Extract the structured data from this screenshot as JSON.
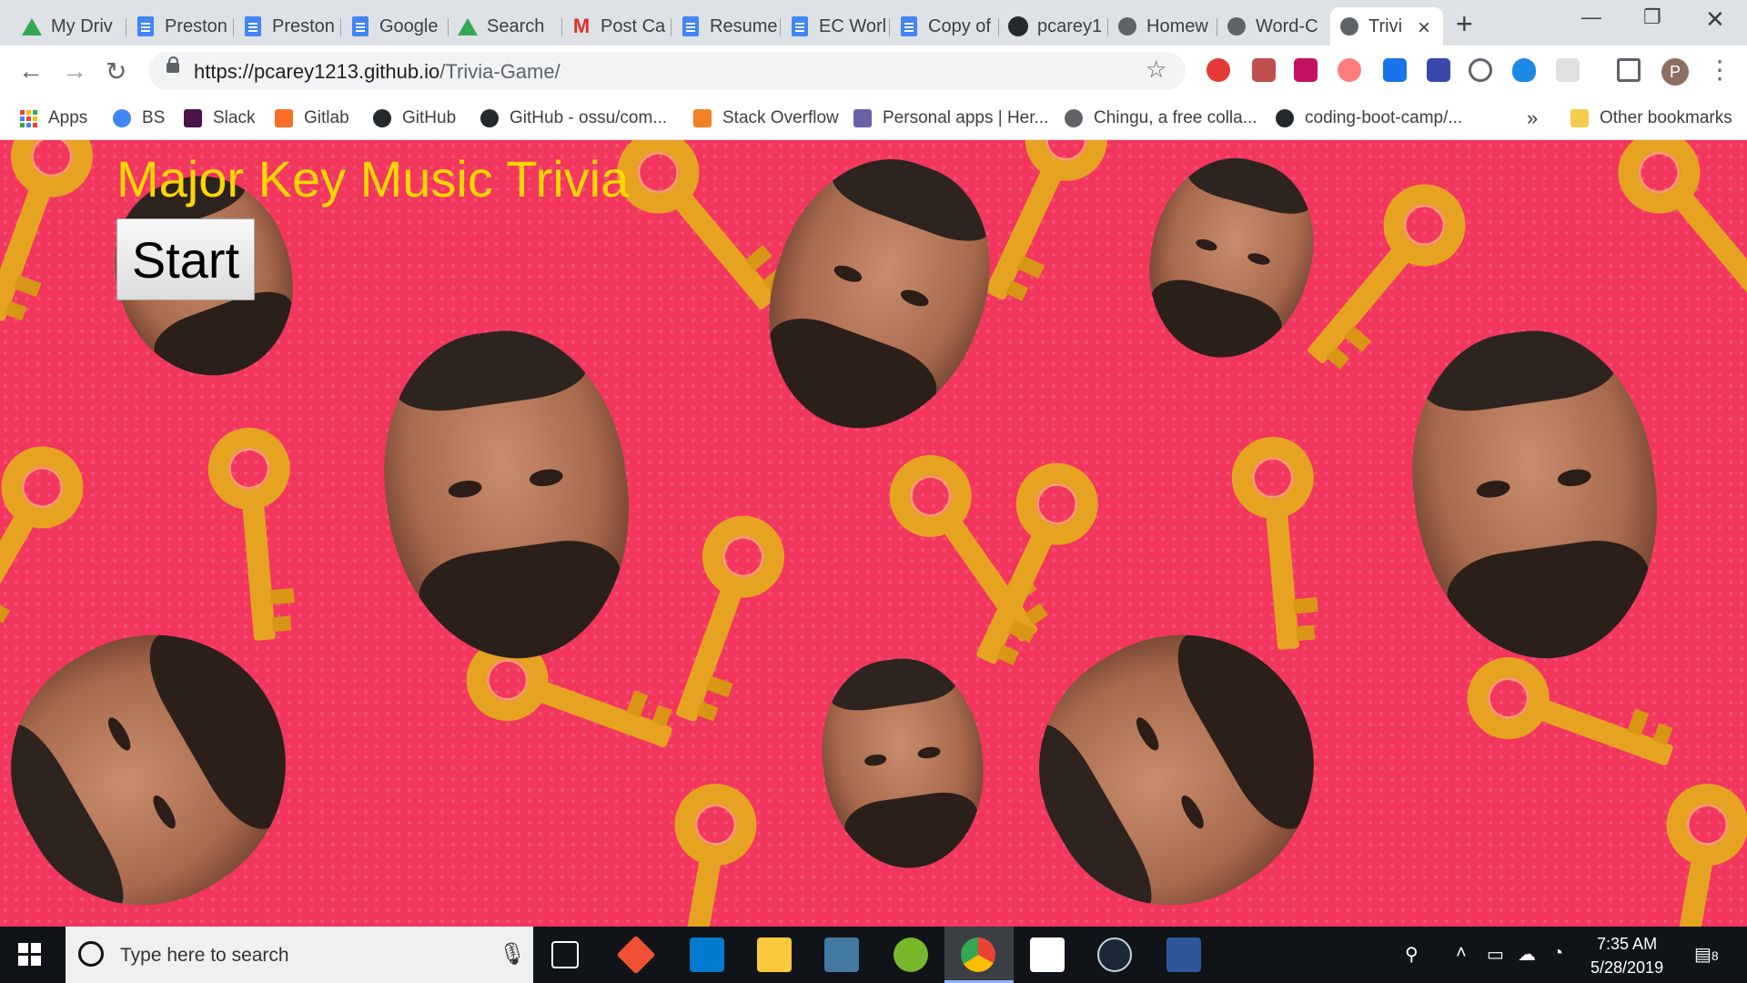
{
  "browser": {
    "tabs": [
      {
        "label": "My Driv",
        "icon": "drive-icon"
      },
      {
        "label": "Preston",
        "icon": "docs-icon"
      },
      {
        "label": "Preston",
        "icon": "docs-icon"
      },
      {
        "label": "Google",
        "icon": "docs-icon"
      },
      {
        "label": "Search",
        "icon": "drive-icon"
      },
      {
        "label": "Post Ca",
        "icon": "gmail-icon"
      },
      {
        "label": "Resume",
        "icon": "docs-icon"
      },
      {
        "label": "EC Worl",
        "icon": "docs-icon"
      },
      {
        "label": "Copy of",
        "icon": "docs-icon"
      },
      {
        "label": "pcarey1",
        "icon": "github-icon"
      },
      {
        "label": "Homew",
        "icon": "globe-icon"
      },
      {
        "label": "Word-C",
        "icon": "globe-icon"
      },
      {
        "label": "Trivi",
        "icon": "globe-icon"
      }
    ],
    "url_host": "https://pcarey1213.github.io",
    "url_path": "/Trivia-Game/",
    "profile_initial": "P",
    "bookmarks": [
      {
        "label": "Apps",
        "icon": "apps-icon"
      },
      {
        "label": "BS",
        "icon": "google-icon"
      },
      {
        "label": "Slack",
        "icon": "slack-icon"
      },
      {
        "label": "Gitlab",
        "icon": "gitlab-icon"
      },
      {
        "label": "GitHub",
        "icon": "github-icon"
      },
      {
        "label": "GitHub - ossu/com...",
        "icon": "github-icon"
      },
      {
        "label": "Stack Overflow",
        "icon": "stackoverflow-icon"
      },
      {
        "label": "Personal apps | Her...",
        "icon": "heroku-icon"
      },
      {
        "label": "Chingu, a free colla...",
        "icon": "globe-icon"
      },
      {
        "label": "coding-boot-camp/...",
        "icon": "github-icon"
      }
    ],
    "overflow_label": "»",
    "other_bookmarks": "Other bookmarks"
  },
  "page": {
    "title": "Major Key Music Trivia",
    "start_label": "Start",
    "background_color": "#f2365e",
    "title_color": "#ffd700"
  },
  "taskbar": {
    "search_placeholder": "Type here to search",
    "time": "7:35 AM",
    "date": "5/28/2019",
    "notification_count": "8",
    "apps": [
      "task-view-icon",
      "git-icon",
      "vscode-icon",
      "file-explorer-icon",
      "mysql-icon",
      "utorrent-icon",
      "chrome-icon",
      "mail-icon",
      "steam-icon",
      "word-icon"
    ]
  }
}
